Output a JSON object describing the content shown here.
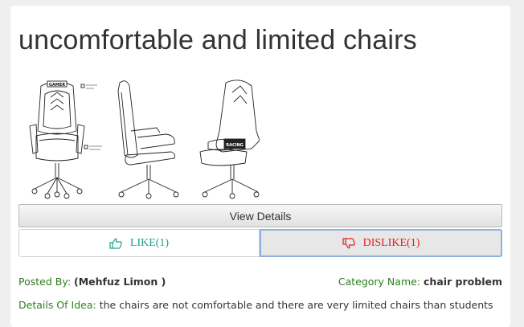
{
  "idea": {
    "title": "uncomfortable and limited chairs",
    "image_alt": "gaming chair drawing",
    "image_text": {
      "front_badge": "GAMER",
      "side_badge": "RACING"
    }
  },
  "actions": {
    "view_label": "View Details",
    "like_label": "LIKE(1)",
    "dislike_label": "DISLIKE(1)"
  },
  "meta": {
    "posted_by_label": "Posted By:",
    "posted_by_value": "(Mehfuz Limon )",
    "category_label": "Category Name:",
    "category_value": "chair problem",
    "details_label": "Details Of Idea:",
    "details_value": "the chairs are not comfortable and there are very limited chairs than students"
  },
  "colors": {
    "label_green": "#2e7d1e",
    "like_teal": "#20a08a",
    "dislike_red": "#e02020"
  }
}
